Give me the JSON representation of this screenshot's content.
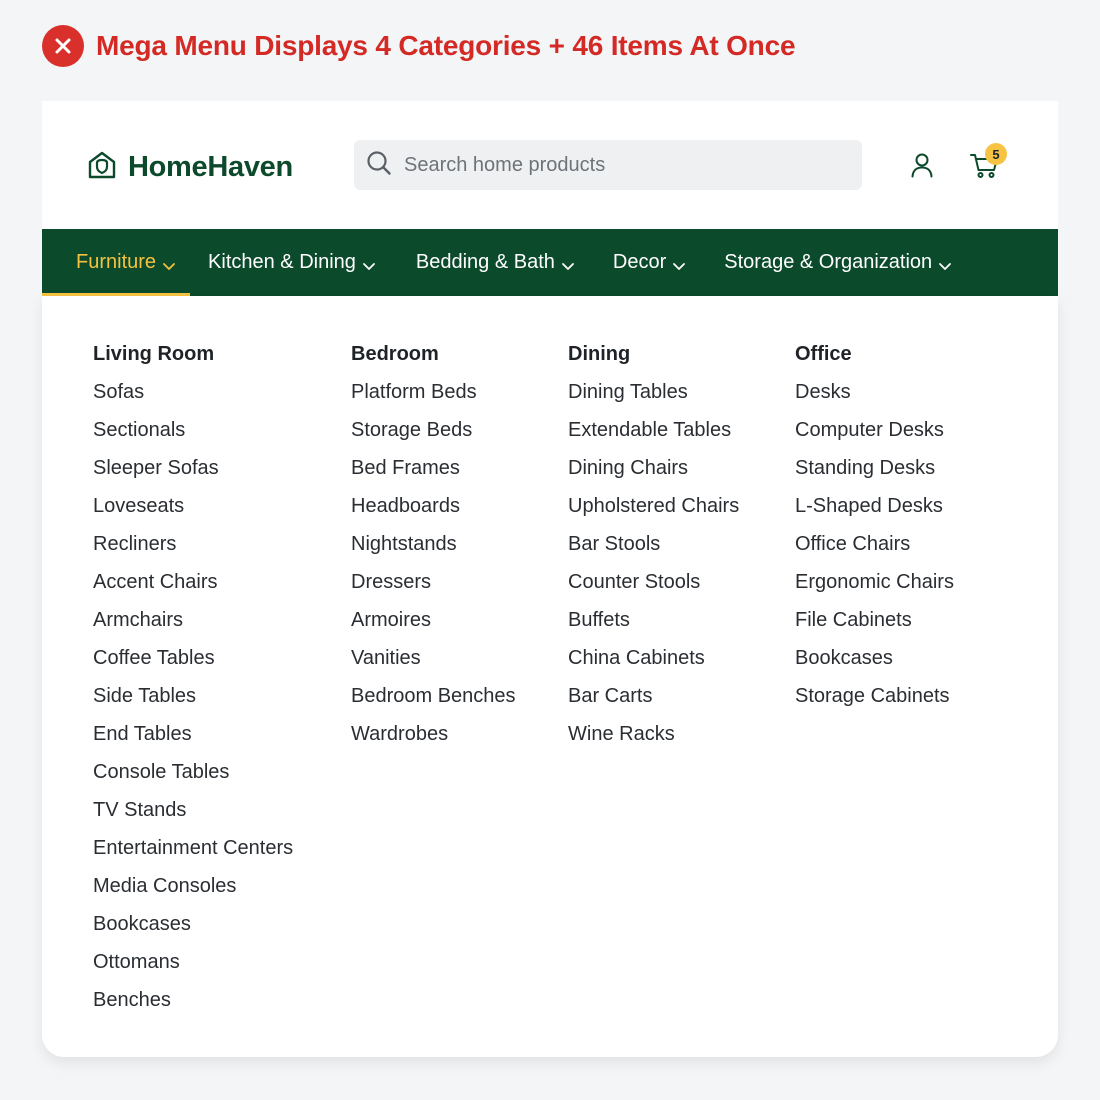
{
  "verdict": {
    "title": "Mega Menu Displays 4 Categories + 46 Items At Once",
    "icon": "close-circle-icon",
    "color": "#d42a25"
  },
  "header": {
    "brand": "HomeHaven",
    "logo_icon": "house-shield-icon",
    "brand_color": "#0d4a2b",
    "search_placeholder": "Search home products",
    "account_icon": "user-icon",
    "cart_icon": "cart-icon",
    "cart_count": "5",
    "badge_color": "#f6c343"
  },
  "nav": {
    "background": "#0c4a2c",
    "active_color": "#f4c23f",
    "items": [
      {
        "label": "Furniture",
        "active": true
      },
      {
        "label": "Kitchen & Dining",
        "active": false
      },
      {
        "label": "Bedding & Bath",
        "active": false
      },
      {
        "label": "Decor",
        "active": false
      },
      {
        "label": "Storage & Organization",
        "active": false
      }
    ]
  },
  "mega_menu": {
    "columns": [
      {
        "heading": "Living Room",
        "items": [
          "Sofas",
          "Sectionals",
          "Sleeper Sofas",
          "Loveseats",
          "Recliners",
          "Accent Chairs",
          "Armchairs",
          "Coffee Tables",
          "Side Tables",
          "End Tables",
          "Console Tables",
          "TV Stands",
          "Entertainment Centers",
          "Media Consoles",
          "Bookcases",
          "Ottomans",
          "Benches"
        ]
      },
      {
        "heading": "Bedroom",
        "items": [
          "Platform Beds",
          "Storage Beds",
          "Bed Frames",
          "Headboards",
          "Nightstands",
          "Dressers",
          "Armoires",
          "Vanities",
          "Bedroom Benches",
          "Wardrobes"
        ]
      },
      {
        "heading": "Dining",
        "items": [
          "Dining Tables",
          "Extendable Tables",
          "Dining Chairs",
          "Upholstered Chairs",
          "Bar Stools",
          "Counter Stools",
          "Buffets",
          "China Cabinets",
          "Bar Carts",
          "Wine Racks"
        ]
      },
      {
        "heading": "Office",
        "items": [
          "Desks",
          "Computer Desks",
          "Standing Desks",
          "L-Shaped Desks",
          "Office Chairs",
          "Ergonomic Chairs",
          "File Cabinets",
          "Bookcases",
          "Storage Cabinets"
        ]
      }
    ]
  }
}
